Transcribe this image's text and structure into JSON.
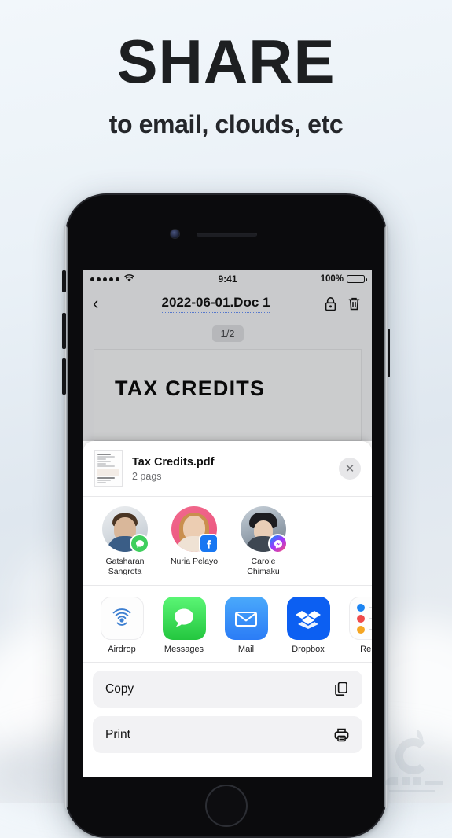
{
  "promo": {
    "headline": "SHARE",
    "subheadline": "to email, clouds, etc"
  },
  "phone": {
    "statusbar": {
      "time": "9:41",
      "battery_label": "100%",
      "signal_icon": "signal-dots-icon",
      "wifi_icon": "wifi-icon",
      "battery_icon": "battery-full-icon"
    },
    "navbar": {
      "back_icon": "chevron-left-icon",
      "title": "2022-06-01.Doc 1",
      "lock_icon": "lock-icon",
      "trash_icon": "trash-icon"
    },
    "document": {
      "page_indicator": "1/2",
      "heading": "TAX CREDITS"
    }
  },
  "share_sheet": {
    "file": {
      "name": "Tax Credits.pdf",
      "subtitle": "2 pags",
      "thumbnail_icon": "document-thumbnail-icon"
    },
    "close_icon": "close-icon",
    "close_glyph": "✕",
    "contacts": [
      {
        "name": "Gatsharan Sangrota",
        "badge": "messages-badge-icon"
      },
      {
        "name": "Nuria Pelayo",
        "badge": "facebook-badge-icon"
      },
      {
        "name": "Carole Chimaku",
        "badge": "messenger-badge-icon"
      }
    ],
    "apps": [
      {
        "label": "Airdrop",
        "icon": "airdrop-icon"
      },
      {
        "label": "Messages",
        "icon": "messages-icon"
      },
      {
        "label": "Mail",
        "icon": "mail-icon"
      },
      {
        "label": "Dropbox",
        "icon": "dropbox-icon"
      },
      {
        "label": "Remi",
        "icon": "reminders-icon"
      }
    ],
    "actions": [
      {
        "label": "Copy",
        "icon": "copy-icon"
      },
      {
        "label": "Print",
        "icon": "print-icon"
      }
    ]
  },
  "colors": {
    "accent_blue": "#2b7cf6",
    "messages_green": "#24c63f",
    "dropbox_blue": "#0c5ff2",
    "facebook_blue": "#1877f2",
    "chrome_gray": "#c9cacc"
  }
}
